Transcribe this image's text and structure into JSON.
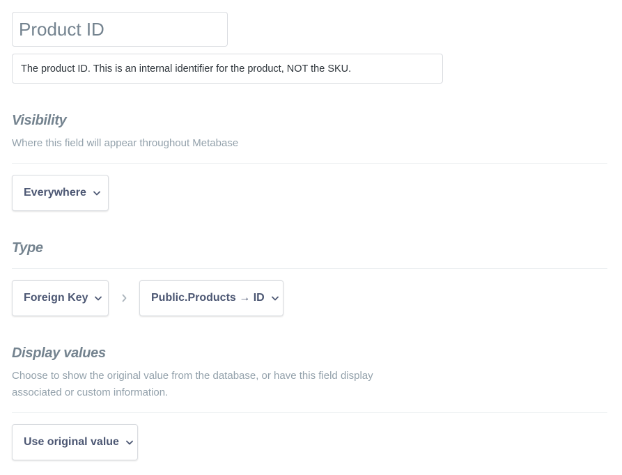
{
  "field": {
    "name_value": "Product ID",
    "description_value": "The product ID. This is an internal identifier for the product, NOT the SKU."
  },
  "visibility": {
    "title": "Visibility",
    "description": "Where this field will appear throughout Metabase",
    "selected": "Everywhere"
  },
  "type": {
    "title": "Type",
    "selected": "Foreign Key",
    "target": "Public.Products → ID"
  },
  "display_values": {
    "title": "Display values",
    "description_line1": "Choose to show the original value from the database, or have this field display",
    "description_line2": "associated or custom information.",
    "selected": "Use original value"
  },
  "icons": {
    "dropdown": "chevron-down-icon",
    "separator": "chevron-right-icon"
  },
  "colors": {
    "border": "#d9dce0",
    "text_dark": "#4c5773",
    "text_muted": "#93a1ab",
    "title": "#74838f"
  }
}
